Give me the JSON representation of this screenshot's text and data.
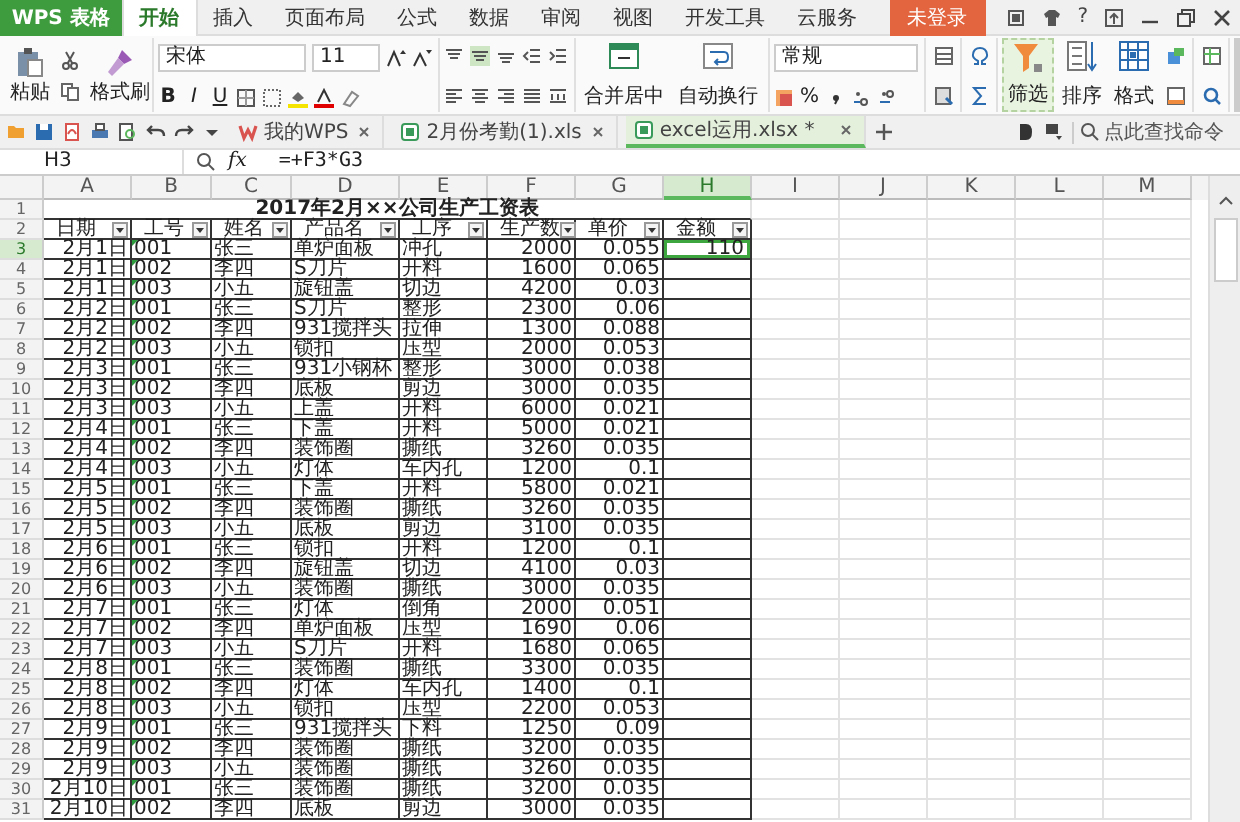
{
  "app_button": "WPS 表格",
  "menu_tabs": [
    {
      "label": "开始",
      "selected": true
    },
    {
      "label": "插入",
      "selected": false
    },
    {
      "label": "页面布局",
      "selected": false
    },
    {
      "label": "公式",
      "selected": false
    },
    {
      "label": "数据",
      "selected": false
    },
    {
      "label": "审阅",
      "selected": false
    },
    {
      "label": "视图",
      "selected": false
    },
    {
      "label": "开发工具",
      "selected": false
    },
    {
      "label": "云服务",
      "selected": false
    }
  ],
  "login_button": "未登录",
  "help": "?",
  "ribbon": {
    "paste": "粘贴",
    "format_painter": "格式刷",
    "font": "宋体",
    "font_size": "11",
    "bold": "B",
    "italic": "I",
    "underline": "U",
    "merge": "合并居中",
    "wrap": "自动换行",
    "number_format": "常规",
    "percent": "%",
    "filter": "筛选",
    "sort": "排序",
    "format": "格式"
  },
  "doc_tabs": [
    {
      "label": "我的WPS",
      "selected": false,
      "kind": "home"
    },
    {
      "label": "2月份考勤(1).xls",
      "selected": false,
      "kind": "sheet"
    },
    {
      "label": "excel运用.xlsx *",
      "selected": true,
      "kind": "sheet"
    }
  ],
  "command_search": {
    "placeholder": "点此查找命令"
  },
  "name_box": "H3",
  "fx": "fx",
  "formula": "=+F3*G3",
  "columns": [
    {
      "label": "A",
      "selected": false
    },
    {
      "label": "B",
      "selected": false
    },
    {
      "label": "C",
      "selected": false
    },
    {
      "label": "D",
      "selected": false
    },
    {
      "label": "E",
      "selected": false
    },
    {
      "label": "F",
      "selected": false
    },
    {
      "label": "G",
      "selected": false
    },
    {
      "label": "H",
      "selected": true
    },
    {
      "label": "I",
      "selected": false
    },
    {
      "label": "J",
      "selected": false
    },
    {
      "label": "K",
      "selected": false
    },
    {
      "label": "L",
      "selected": false
    },
    {
      "label": "M",
      "selected": false
    }
  ],
  "title_row": {
    "num": "1",
    "text": "2017年2月××公司生产工资表"
  },
  "header_row": {
    "num": "2",
    "cells": [
      "日期",
      "工号",
      "姓名",
      "产品名",
      "工序",
      "生产数",
      "单价",
      "金额"
    ]
  },
  "rows": [
    {
      "num": "3",
      "selected": true,
      "cells": [
        "2月1日",
        "001",
        "张三",
        "单炉面板",
        "冲孔",
        "2000",
        "0.055",
        "110"
      ]
    },
    {
      "num": "4",
      "selected": false,
      "cells": [
        "2月1日",
        "002",
        "李四",
        "S刀片",
        "开料",
        "1600",
        "0.065",
        ""
      ]
    },
    {
      "num": "5",
      "selected": false,
      "cells": [
        "2月1日",
        "003",
        "小五",
        "旋钮盖",
        "切边",
        "4200",
        "0.03",
        ""
      ]
    },
    {
      "num": "6",
      "selected": false,
      "cells": [
        "2月2日",
        "001",
        "张三",
        "S刀片",
        "整形",
        "2300",
        "0.06",
        ""
      ]
    },
    {
      "num": "7",
      "selected": false,
      "cells": [
        "2月2日",
        "002",
        "李四",
        "931搅拌头",
        "拉伸",
        "1300",
        "0.088",
        ""
      ]
    },
    {
      "num": "8",
      "selected": false,
      "cells": [
        "2月2日",
        "003",
        "小五",
        "锁扣",
        "压型",
        "2000",
        "0.053",
        ""
      ]
    },
    {
      "num": "9",
      "selected": false,
      "cells": [
        "2月3日",
        "001",
        "张三",
        "931小钢杯",
        "整形",
        "3000",
        "0.038",
        ""
      ]
    },
    {
      "num": "10",
      "selected": false,
      "cells": [
        "2月3日",
        "002",
        "李四",
        "底板",
        "剪边",
        "3000",
        "0.035",
        ""
      ]
    },
    {
      "num": "11",
      "selected": false,
      "cells": [
        "2月3日",
        "003",
        "小五",
        "上盖",
        "开料",
        "6000",
        "0.021",
        ""
      ]
    },
    {
      "num": "12",
      "selected": false,
      "cells": [
        "2月4日",
        "001",
        "张三",
        "下盖",
        "开料",
        "5000",
        "0.021",
        ""
      ]
    },
    {
      "num": "13",
      "selected": false,
      "cells": [
        "2月4日",
        "002",
        "李四",
        "装饰圈",
        "撕纸",
        "3260",
        "0.035",
        ""
      ]
    },
    {
      "num": "14",
      "selected": false,
      "cells": [
        "2月4日",
        "003",
        "小五",
        "灯体",
        "车内孔",
        "1200",
        "0.1",
        ""
      ]
    },
    {
      "num": "15",
      "selected": false,
      "cells": [
        "2月5日",
        "001",
        "张三",
        "下盖",
        "开料",
        "5800",
        "0.021",
        ""
      ]
    },
    {
      "num": "16",
      "selected": false,
      "cells": [
        "2月5日",
        "002",
        "李四",
        "装饰圈",
        "撕纸",
        "3260",
        "0.035",
        ""
      ]
    },
    {
      "num": "17",
      "selected": false,
      "cells": [
        "2月5日",
        "003",
        "小五",
        "底板",
        "剪边",
        "3100",
        "0.035",
        ""
      ]
    },
    {
      "num": "18",
      "selected": false,
      "cells": [
        "2月6日",
        "001",
        "张三",
        "锁扣",
        "开料",
        "1200",
        "0.1",
        ""
      ]
    },
    {
      "num": "19",
      "selected": false,
      "cells": [
        "2月6日",
        "002",
        "李四",
        "旋钮盖",
        "切边",
        "4100",
        "0.03",
        ""
      ]
    },
    {
      "num": "20",
      "selected": false,
      "cells": [
        "2月6日",
        "003",
        "小五",
        "装饰圈",
        "撕纸",
        "3000",
        "0.035",
        ""
      ]
    },
    {
      "num": "21",
      "selected": false,
      "cells": [
        "2月7日",
        "001",
        "张三",
        "灯体",
        "倒角",
        "2000",
        "0.051",
        ""
      ]
    },
    {
      "num": "22",
      "selected": false,
      "cells": [
        "2月7日",
        "002",
        "李四",
        "单炉面板",
        "压型",
        "1690",
        "0.06",
        ""
      ]
    },
    {
      "num": "23",
      "selected": false,
      "cells": [
        "2月7日",
        "003",
        "小五",
        "S刀片",
        "开料",
        "1680",
        "0.065",
        ""
      ]
    },
    {
      "num": "24",
      "selected": false,
      "cells": [
        "2月8日",
        "001",
        "张三",
        "装饰圈",
        "撕纸",
        "3300",
        "0.035",
        ""
      ]
    },
    {
      "num": "25",
      "selected": false,
      "cells": [
        "2月8日",
        "002",
        "李四",
        "灯体",
        "车内孔",
        "1400",
        "0.1",
        ""
      ]
    },
    {
      "num": "26",
      "selected": false,
      "cells": [
        "2月8日",
        "003",
        "小五",
        "锁扣",
        "压型",
        "2200",
        "0.053",
        ""
      ]
    },
    {
      "num": "27",
      "selected": false,
      "cells": [
        "2月9日",
        "001",
        "张三",
        "931搅拌头",
        "下料",
        "1250",
        "0.09",
        ""
      ]
    },
    {
      "num": "28",
      "selected": false,
      "cells": [
        "2月9日",
        "002",
        "李四",
        "装饰圈",
        "撕纸",
        "3200",
        "0.035",
        ""
      ]
    },
    {
      "num": "29",
      "selected": false,
      "cells": [
        "2月9日",
        "003",
        "小五",
        "装饰圈",
        "撕纸",
        "3260",
        "0.035",
        ""
      ]
    },
    {
      "num": "30",
      "selected": false,
      "cells": [
        "2月10日",
        "001",
        "张三",
        "装饰圈",
        "撕纸",
        "3200",
        "0.035",
        ""
      ]
    },
    {
      "num": "31",
      "selected": false,
      "cells": [
        "2月10日",
        "002",
        "李四",
        "底板",
        "剪边",
        "3000",
        "0.035",
        ""
      ]
    }
  ]
}
